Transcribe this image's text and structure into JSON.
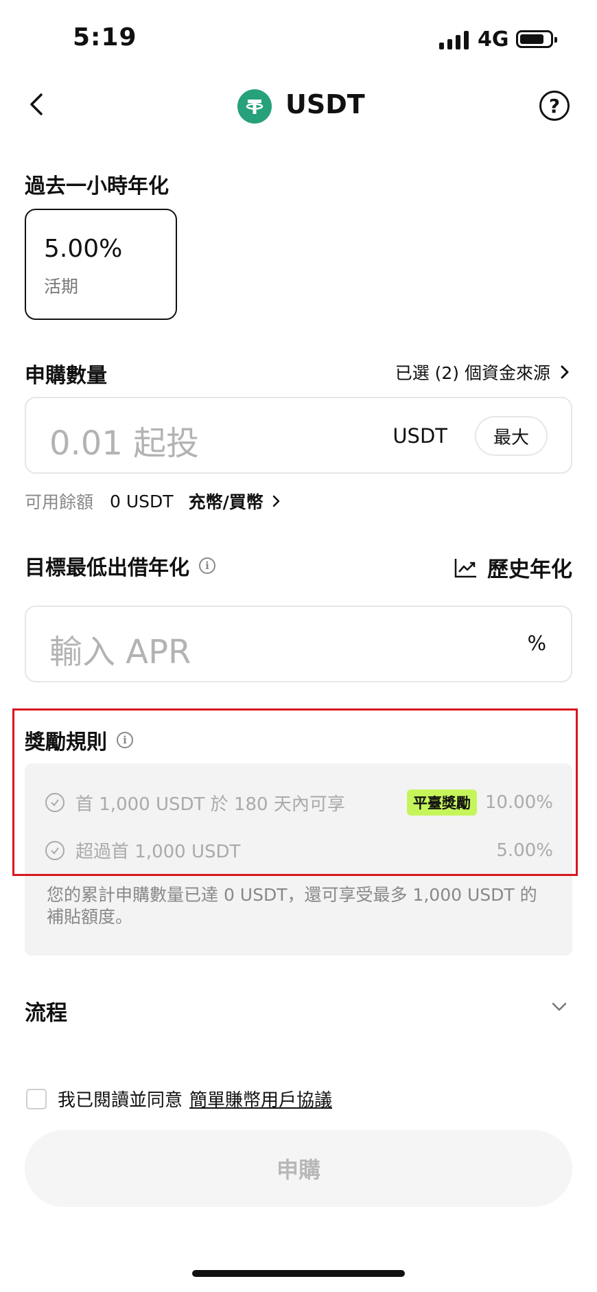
{
  "status_bar": {
    "time": "5:19",
    "network": "4G"
  },
  "nav": {
    "title": "USDT"
  },
  "apy": {
    "label": "過去一小時年化",
    "value": "5.00%",
    "type": "活期"
  },
  "subscribe": {
    "label": "申購數量",
    "sources": "已選 (2) 個資金來源",
    "placeholder": "0.01 起投",
    "unit": "USDT",
    "max": "最大"
  },
  "balance": {
    "label": "可用餘額",
    "value": "0 USDT",
    "deposit": "充幣/買幣"
  },
  "target": {
    "label": "目標最低出借年化",
    "history": "歷史年化",
    "placeholder": "輸入 APR",
    "unit": "%"
  },
  "reward": {
    "label": "獎勵規則",
    "rules": [
      {
        "text": "首 1,000 USDT 於 180 天內可享",
        "badge": "平臺獎勵",
        "rate": "10.00%"
      },
      {
        "text": "超過首 1,000 USDT",
        "rate": "5.00%"
      }
    ],
    "note": "您的累計申購數量已達 0 USDT，還可享受最多 1,000 USDT 的補貼額度。"
  },
  "process": {
    "label": "流程"
  },
  "agreement": {
    "text": "我已閱讀並同意",
    "link": "簡單賺幣用戶協議"
  },
  "submit": {
    "label": "申購"
  },
  "colors": {
    "accent_badge": "#c5f55a",
    "highlight": "#d9161f",
    "coin": "#26a17b"
  }
}
